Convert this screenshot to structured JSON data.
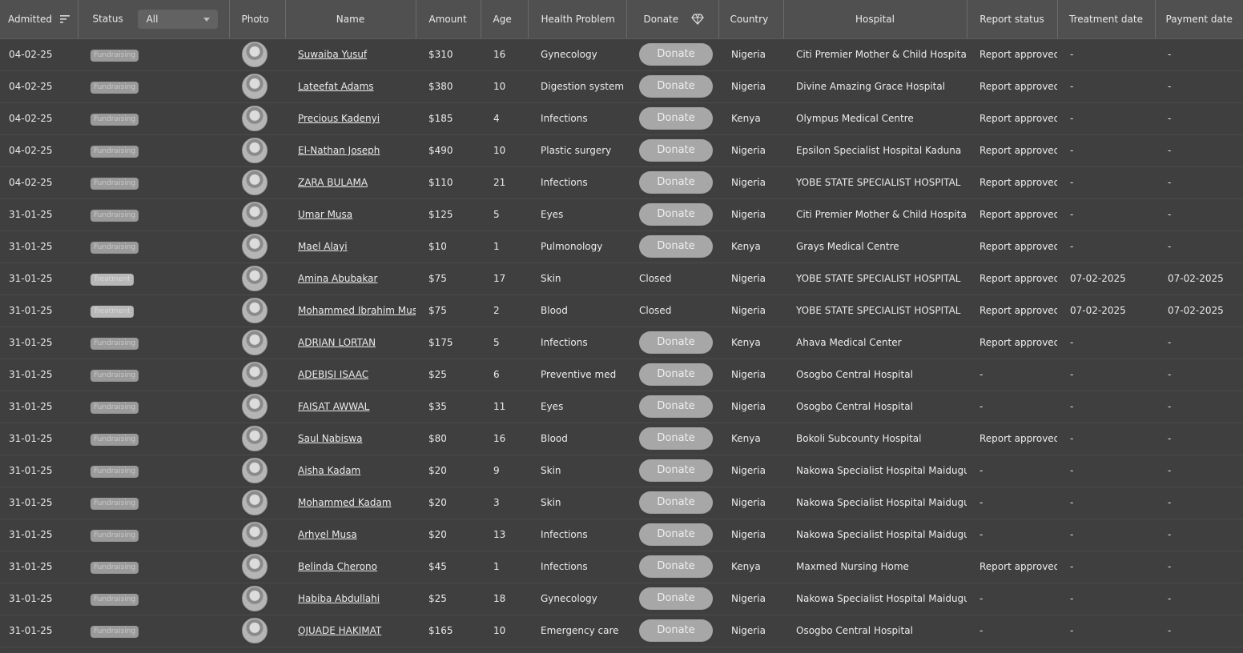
{
  "header": {
    "admitted": "Admitted",
    "status": "Status",
    "status_filter": "All",
    "photo": "Photo",
    "name": "Name",
    "amount": "Amount",
    "age": "Age",
    "health_problem": "Health Problem",
    "donate": "Donate",
    "country": "Country",
    "hospital": "Hospital",
    "report_status": "Report status",
    "treatment_date": "Treatment date",
    "payment_date": "Payment date"
  },
  "donate_label": "Donate",
  "icons": {
    "sort": "sort-lines-icon",
    "filter_caret": "chevron-down-icon",
    "donate": "diamond-heart-icon"
  },
  "rows": [
    {
      "admitted": "04-02-25",
      "status": "Fundraising",
      "name": "Suwaiba Yusuf",
      "amount": "$310",
      "age": "16",
      "health": "Gynecology",
      "donate": "button",
      "country": "Nigeria",
      "hospital": "Citi Premier Mother & Child Hospital",
      "report": "Report approved",
      "treatment": "-",
      "payment": "-"
    },
    {
      "admitted": "04-02-25",
      "status": "Fundraising",
      "name": "Lateefat Adams",
      "amount": "$380",
      "age": "10",
      "health": "Digestion system",
      "donate": "button",
      "country": "Nigeria",
      "hospital": "Divine Amazing Grace Hospital",
      "report": "Report approved",
      "treatment": "-",
      "payment": "-"
    },
    {
      "admitted": "04-02-25",
      "status": "Fundraising",
      "name": "Precious Kadenyi",
      "amount": "$185",
      "age": "4",
      "health": "Infections",
      "donate": "button",
      "country": "Kenya",
      "hospital": "Olympus Medical Centre",
      "report": "Report approved",
      "treatment": "-",
      "payment": "-"
    },
    {
      "admitted": "04-02-25",
      "status": "Fundraising",
      "name": "El-Nathan Joseph",
      "amount": "$490",
      "age": "10",
      "health": "Plastic surgery",
      "donate": "button",
      "country": "Nigeria",
      "hospital": "Epsilon Specialist Hospital Kaduna",
      "report": "Report approved",
      "treatment": "-",
      "payment": "-"
    },
    {
      "admitted": "04-02-25",
      "status": "Fundraising",
      "name": "ZARA BULAMA",
      "amount": "$110",
      "age": "21",
      "health": "Infections",
      "donate": "button",
      "country": "Nigeria",
      "hospital": "YOBE STATE SPECIALIST HOSPITAL",
      "report": "Report approved",
      "treatment": "-",
      "payment": "-"
    },
    {
      "admitted": "31-01-25",
      "status": "Fundraising",
      "name": "Umar Musa",
      "amount": "$125",
      "age": "5",
      "health": "Eyes",
      "donate": "button",
      "country": "Nigeria",
      "hospital": "Citi Premier Mother & Child Hospital",
      "report": "Report approved",
      "treatment": "-",
      "payment": "-"
    },
    {
      "admitted": "31-01-25",
      "status": "Fundraising",
      "name": "Mael Alayi",
      "amount": "$10",
      "age": "1",
      "health": "Pulmonology",
      "donate": "button",
      "country": "Kenya",
      "hospital": "Grays Medical Centre",
      "report": "Report approved",
      "treatment": "-",
      "payment": "-"
    },
    {
      "admitted": "31-01-25",
      "status": "Treatment",
      "name": "Amina Abubakar",
      "amount": "$75",
      "age": "17",
      "health": "Skin",
      "donate": "Closed",
      "country": "Nigeria",
      "hospital": "YOBE STATE SPECIALIST HOSPITAL",
      "report": "Report approved",
      "treatment": "07-02-2025",
      "payment": "07-02-2025"
    },
    {
      "admitted": "31-01-25",
      "status": "Treatment",
      "name": "Mohammed Ibrahim Musa",
      "amount": "$75",
      "age": "2",
      "health": "Blood",
      "donate": "Closed",
      "country": "Nigeria",
      "hospital": "YOBE STATE SPECIALIST HOSPITAL",
      "report": "Report approved",
      "treatment": "07-02-2025",
      "payment": "07-02-2025"
    },
    {
      "admitted": "31-01-25",
      "status": "Fundraising",
      "name": "ADRIAN LORTAN",
      "amount": "$175",
      "age": "5",
      "health": "Infections",
      "donate": "button",
      "country": "Kenya",
      "hospital": "Ahava Medical Center",
      "report": "Report approved",
      "treatment": "-",
      "payment": "-"
    },
    {
      "admitted": "31-01-25",
      "status": "Fundraising",
      "name": "ADEBISI ISAAC",
      "amount": "$25",
      "age": "6",
      "health": "Preventive med",
      "donate": "button",
      "country": "Nigeria",
      "hospital": "Osogbo Central Hospital",
      "report": "-",
      "treatment": "-",
      "payment": "-"
    },
    {
      "admitted": "31-01-25",
      "status": "Fundraising",
      "name": "FAISAT AWWAL",
      "amount": "$35",
      "age": "11",
      "health": "Eyes",
      "donate": "button",
      "country": "Nigeria",
      "hospital": "Osogbo Central Hospital",
      "report": "-",
      "treatment": "-",
      "payment": "-"
    },
    {
      "admitted": "31-01-25",
      "status": "Fundraising",
      "name": "Saul Nabiswa",
      "amount": "$80",
      "age": "16",
      "health": "Blood",
      "donate": "button",
      "country": "Kenya",
      "hospital": "Bokoli Subcounty Hospital",
      "report": "Report approved",
      "treatment": "-",
      "payment": "-"
    },
    {
      "admitted": "31-01-25",
      "status": "Fundraising",
      "name": "Aisha Kadam",
      "amount": "$20",
      "age": "9",
      "health": "Skin",
      "donate": "button",
      "country": "Nigeria",
      "hospital": "Nakowa Specialist Hospital Maiduguri",
      "report": "-",
      "treatment": "-",
      "payment": "-"
    },
    {
      "admitted": "31-01-25",
      "status": "Fundraising",
      "name": "Mohammed Kadam",
      "amount": "$20",
      "age": "3",
      "health": "Skin",
      "donate": "button",
      "country": "Nigeria",
      "hospital": "Nakowa Specialist Hospital Maiduguri",
      "report": "-",
      "treatment": "-",
      "payment": "-"
    },
    {
      "admitted": "31-01-25",
      "status": "Fundraising",
      "name": "Arhyel Musa",
      "amount": "$20",
      "age": "13",
      "health": "Infections",
      "donate": "button",
      "country": "Nigeria",
      "hospital": "Nakowa Specialist Hospital Maiduguri",
      "report": "-",
      "treatment": "-",
      "payment": "-"
    },
    {
      "admitted": "31-01-25",
      "status": "Fundraising",
      "name": "Belinda Cherono",
      "amount": "$45",
      "age": "1",
      "health": "Infections",
      "donate": "button",
      "country": "Kenya",
      "hospital": "Maxmed Nursing Home",
      "report": "Report approved",
      "treatment": "-",
      "payment": "-"
    },
    {
      "admitted": "31-01-25",
      "status": "Fundraising",
      "name": "Habiba Abdullahi",
      "amount": "$25",
      "age": "18",
      "health": "Gynecology",
      "donate": "button",
      "country": "Nigeria",
      "hospital": "Nakowa Specialist Hospital Maiduguri",
      "report": "-",
      "treatment": "-",
      "payment": "-"
    },
    {
      "admitted": "31-01-25",
      "status": "Fundraising",
      "name": "OJUADE HAKIMAT",
      "amount": "$165",
      "age": "10",
      "health": "Emergency care",
      "donate": "button",
      "country": "Nigeria",
      "hospital": "Osogbo Central Hospital",
      "report": "-",
      "treatment": "-",
      "payment": "-"
    }
  ]
}
